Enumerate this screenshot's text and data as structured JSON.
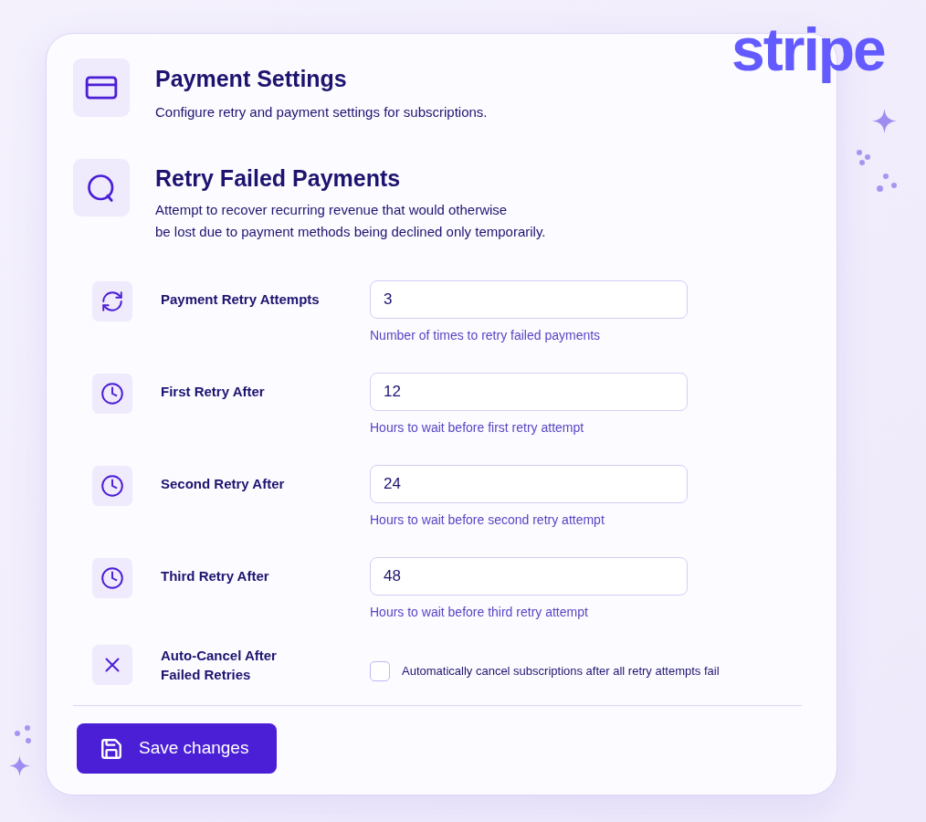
{
  "logo": {
    "text": "stripe"
  },
  "header": {
    "title": "Payment Settings",
    "subtitle": "Configure retry and payment settings for subscriptions."
  },
  "section": {
    "title": "Retry Failed Payments",
    "description": "Attempt to recover recurring revenue that would otherwise\nbe lost due to payment methods being declined only temporarily."
  },
  "fields": [
    {
      "kind": "count",
      "label": "Payment Retry Attempts",
      "value": "3",
      "help": "Number of times to retry failed payments"
    },
    {
      "kind": "delay",
      "label": "First Retry After",
      "value": "12",
      "help": "Hours to wait before first retry attempt"
    },
    {
      "kind": "delay",
      "label": "Second Retry After",
      "value": "24",
      "help": "Hours to wait before second retry attempt"
    },
    {
      "kind": "delay",
      "label": "Third Retry After",
      "value": "48",
      "help": "Hours to wait before third retry attempt"
    },
    {
      "kind": "checkbox",
      "label": "Auto-Cancel After Failed Retries",
      "checked": false,
      "text": "Automatically cancel subscriptions after all retry attempts fail"
    }
  ],
  "save_button": {
    "label": "Save changes"
  }
}
